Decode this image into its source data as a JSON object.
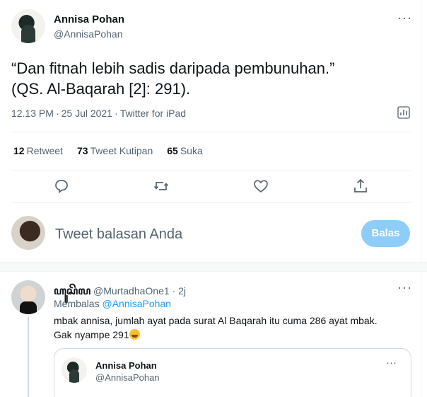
{
  "tweet": {
    "author_name": "Annisa Pohan",
    "author_handle": "@AnnisaPohan",
    "text_line1": "“Dan fitnah lebih sadis daripada pembunuhan.”",
    "text_line2": "(QS. Al-Baqarah [2]: 291).",
    "time": "12.13 PM",
    "date": "25 Jul 2021",
    "source": "Twitter for iPad",
    "more_icon": "···",
    "stats": {
      "retweets_count": "12",
      "retweets_label": "Retweet",
      "quotes_count": "73",
      "quotes_label": "Tweet Kutipan",
      "likes_count": "65",
      "likes_label": "Suka"
    }
  },
  "reply_composer": {
    "placeholder": "Tweet balasan Anda",
    "button_label": "Balas",
    "button_color": "#8ecdf8"
  },
  "reply": {
    "display_name": "ꦲꦸꦱꦼꦭ",
    "handle": "@MurtadhaOne1",
    "dot": "·",
    "time": "2j",
    "more_icon": "···",
    "replying_to_label": "Membalas",
    "replying_to_mention": "@AnnisaPohan",
    "text_line1": "mbak annisa, jumlah ayat pada surat Al Baqarah itu cuma 286 ayat mbak.",
    "text_line2": "Gak nyampe 291",
    "quoted": {
      "author_name": "Annisa Pohan",
      "author_handle": "@AnnisaPohan",
      "more_icon": "···"
    }
  },
  "colors": {
    "accent": "#1d9bf0",
    "secondary_text": "#536471",
    "divider": "#eff3f4"
  }
}
